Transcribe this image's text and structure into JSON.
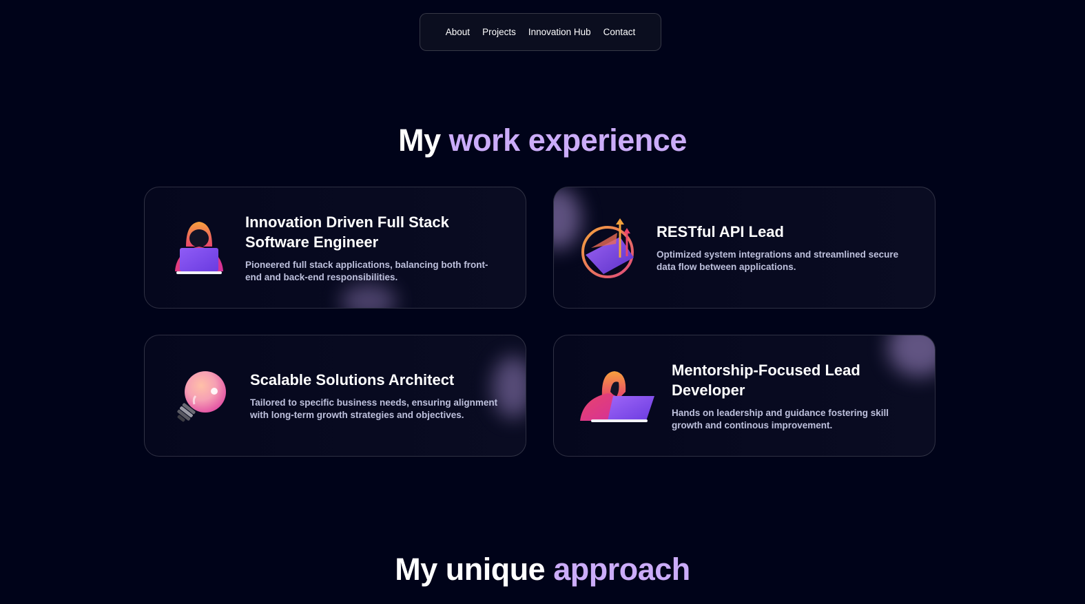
{
  "nav": {
    "items": [
      "About",
      "Projects",
      "Innovation Hub",
      "Contact"
    ]
  },
  "section1": {
    "title_plain": "My",
    "title_accent": "work experience"
  },
  "experience": [
    {
      "title": "Innovation Driven Full Stack Software Engineer",
      "desc": "Pioneered full stack applications, balancing both front-end and back-end responsibilities.",
      "icon": "hooded-developer-laptop-icon"
    },
    {
      "title": "RESTful API Lead",
      "desc": "Optimized system integrations and streamlined secure data flow between applications.",
      "icon": "growth-chart-laptop-icon"
    },
    {
      "title": "Scalable Solutions Architect",
      "desc": "Tailored to specific business needs, ensuring alignment with long-term growth strategies and objectives.",
      "icon": "lightbulb-icon"
    },
    {
      "title": "Mentorship-Focused Lead Developer",
      "desc": "Hands on leadership and guidance fostering skill growth and continous improvement.",
      "icon": "mentor-laptop-icon"
    }
  ],
  "section2": {
    "title_plain": "My unique",
    "title_accent": "approach"
  },
  "colors": {
    "background": "#000319",
    "accent": "#cbacf9",
    "body_text": "#bec1dd"
  }
}
